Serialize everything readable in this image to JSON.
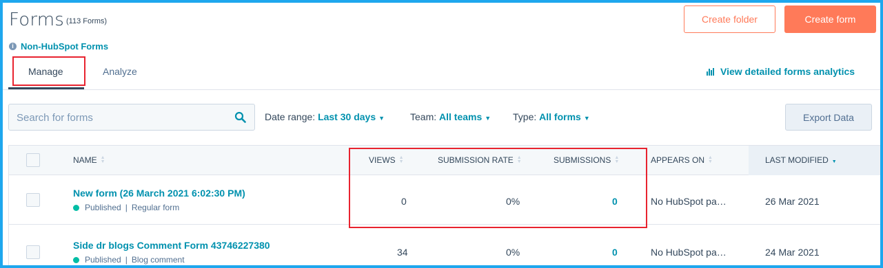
{
  "header": {
    "title": "Forms",
    "count": "(113 Forms)",
    "create_folder": "Create folder",
    "create_form": "Create form",
    "non_hubspot": "Non-HubSpot Forms",
    "info_icon": "info-icon"
  },
  "tabs": [
    {
      "label": "Manage",
      "active": true
    },
    {
      "label": "Analyze",
      "active": false
    }
  ],
  "analytics_link": "View detailed forms analytics",
  "search": {
    "placeholder": "Search for forms"
  },
  "filters": {
    "date_range": {
      "label": "Date range:",
      "value": "Last 30 days"
    },
    "team": {
      "label": "Team:",
      "value": "All teams"
    },
    "type": {
      "label": "Type:",
      "value": "All forms"
    }
  },
  "export_button": "Export Data",
  "table": {
    "columns": [
      "NAME",
      "VIEWS",
      "SUBMISSION RATE",
      "SUBMISSIONS",
      "APPEARS ON",
      "LAST MODIFIED"
    ],
    "rows": [
      {
        "name": "New form (26 March 2021 6:02:30 PM)",
        "status": "Published",
        "form_type": "Regular form",
        "views": "0",
        "submission_rate": "0%",
        "submissions": "0",
        "appears_on": "No HubSpot pa…",
        "last_modified": "26 Mar 2021"
      },
      {
        "name": "Side dr blogs Comment Form 43746227380",
        "status": "Published",
        "form_type": "Blog comment",
        "views": "34",
        "submission_rate": "0%",
        "submissions": "0",
        "appears_on": "No HubSpot pa…",
        "last_modified": "24 Mar 2021"
      }
    ]
  },
  "colors": {
    "accent": "#ff7a59",
    "link": "#0091ae",
    "text": "#33475b",
    "published": "#00bda5",
    "highlight": "#e8232f",
    "border_frame": "#1ea7ee"
  }
}
